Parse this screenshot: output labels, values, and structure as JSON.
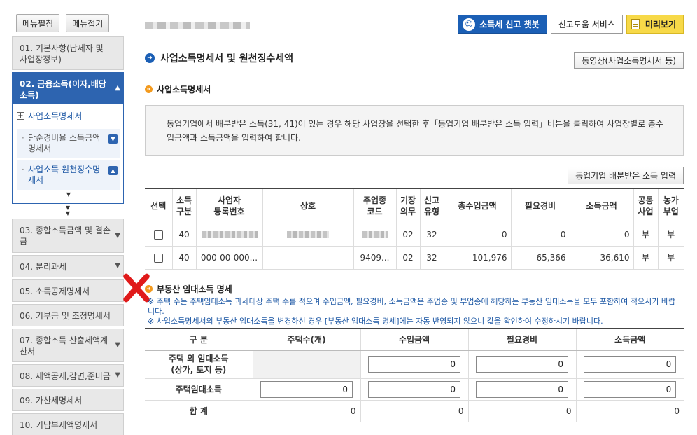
{
  "sidebar": {
    "expand_all": "메뉴펼침",
    "collapse_all": "메뉴접기",
    "items": [
      {
        "label": "01. 기본사항(납세자 및 사업장정보)"
      },
      {
        "label": "02. 금융소득(이자,배당소득)"
      },
      {
        "label": "03. 종합소득금액 및 결손금"
      },
      {
        "label": "04. 분리과세"
      },
      {
        "label": "05. 소득공제명세서"
      },
      {
        "label": "06. 기부금 및 조정명세서"
      },
      {
        "label": "07. 종합소득 산출세액계산서"
      },
      {
        "label": "08. 세액공제,감면,준비금"
      },
      {
        "label": "09. 가산세명세서"
      },
      {
        "label": "10. 기납부세액명세서"
      }
    ],
    "sub_head": "사업소득명세서",
    "sub_items": [
      {
        "label": "단순경비율 소득금액명세서"
      },
      {
        "label": "사업소득 원천징수명세서"
      }
    ]
  },
  "header": {
    "chatbot": "소득세 신고 챗봇",
    "help": "신고도움 서비스",
    "preview": "미리보기"
  },
  "page": {
    "title": "사업소득명세서 및 원천징수세액",
    "video_button": "동영상(사업소득명세서 등)",
    "section1_title": "사업소득명세서",
    "notice": "동업기업에서 배분받은 소득(31, 41)이 있는 경우 해당 사업장을 선택한 후「동업기업 배분받은 소득 입력」버튼을 클릭하여 사업장별로 총수입금액과 소득금액을 입력하여 합니다.",
    "input_button": "동업기업 배분받은 소득 입력"
  },
  "income_table": {
    "headers": [
      "선택",
      "소득구분",
      "사업자등록번호",
      "상호",
      "주업종코드",
      "기장의무",
      "신고유형",
      "총수입금액",
      "필요경비",
      "소득금액",
      "공동사업",
      "농가부업"
    ],
    "rows": [
      {
        "type": "40",
        "reg": "",
        "name": "",
        "code": "",
        "duty": "02",
        "form": "32",
        "revenue": "0",
        "expense": "0",
        "income": "0",
        "joint": "부",
        "farm": "부"
      },
      {
        "type": "40",
        "reg": "000-00-000...",
        "name": "",
        "code": "9409...",
        "duty": "02",
        "form": "32",
        "revenue": "101,976",
        "expense": "65,366",
        "income": "36,610",
        "joint": "부",
        "farm": "부"
      }
    ]
  },
  "rental": {
    "title": "부동산 임대소득 명세",
    "note1": "※ 주택 수는 주택임대소득 과세대상 주택 수를 적으며 수입금액, 필요경비, 소득금액은 주업종 및 부업종에 해당하는 부동산 임대소득을 모두 포함하여 적으시기 바랍니다.",
    "note2": "※ 사업소득명세서의 부동산 임대소득을 변경하신 경우 [부동산 임대소득 명세]에는 자동 반영되지 않으니 값을 확인하여 수정하시기 바랍니다.",
    "headers": [
      "구 분",
      "주택수(개)",
      "수입금액",
      "필요경비",
      "소득금액"
    ],
    "rows": [
      {
        "label": "주택 외 임대소득\n(상가, 토지 등)",
        "count": "",
        "revenue": "0",
        "expense": "0",
        "income": "0"
      },
      {
        "label": "주택임대소득",
        "count": "0",
        "revenue": "0",
        "expense": "0",
        "income": "0"
      },
      {
        "label": "합 계",
        "count": "0",
        "revenue": "0",
        "expense": "0",
        "income": "0"
      }
    ]
  },
  "colors": {
    "accent": "#2d64b0",
    "chatbot": "#1b5fb5",
    "preview": "#f7d948",
    "bullet": "#f39a1e",
    "note": "#1c57a4",
    "mark": "#e01a1a"
  },
  "icons": {
    "chatbot": "robot-face-icon",
    "preview": "document-icon",
    "title": "arrow-circle-icon",
    "section": "arrow-circle-icon",
    "mark": "cross-mark"
  }
}
